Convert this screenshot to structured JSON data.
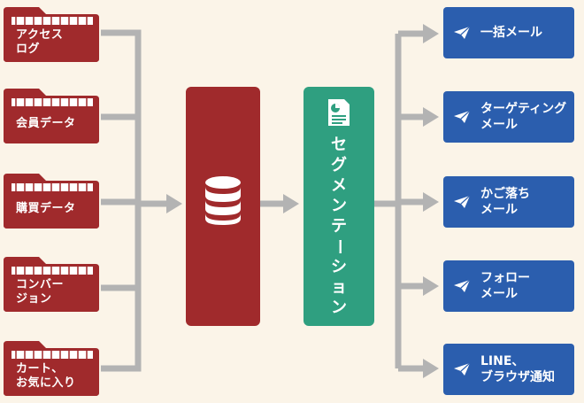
{
  "colors": {
    "background": "#fbf4e8",
    "folder_red": "#a02a2c",
    "segment_green": "#2f9f80",
    "mail_blue": "#2b5eae",
    "connector_gray": "#b3b3b3"
  },
  "sources": [
    {
      "lines": [
        "アクセス",
        "ログ"
      ]
    },
    {
      "lines": [
        "会員データ"
      ]
    },
    {
      "lines": [
        "購買データ"
      ]
    },
    {
      "lines": [
        "コンバー",
        "ジョン"
      ]
    },
    {
      "lines": [
        "カート、",
        "お気に入り"
      ]
    }
  ],
  "database": {
    "icon": "database-icon"
  },
  "segmentation": {
    "icon": "document-icon",
    "chars": [
      "セ",
      "グ",
      "メ",
      "ン",
      "テ",
      "ー",
      "シ",
      "ョ",
      "ン"
    ]
  },
  "outputs": [
    {
      "icon": "paper-plane-icon",
      "lines": [
        "一括メール"
      ]
    },
    {
      "icon": "paper-plane-icon",
      "lines": [
        "ターゲティング",
        "メール"
      ]
    },
    {
      "icon": "paper-plane-icon",
      "lines": [
        "かご落ち",
        "メール"
      ]
    },
    {
      "icon": "paper-plane-icon",
      "lines": [
        "フォロー",
        "メール"
      ]
    },
    {
      "icon": "paper-plane-icon",
      "lines": [
        "LINE、",
        "ブラウザ通知"
      ]
    }
  ]
}
